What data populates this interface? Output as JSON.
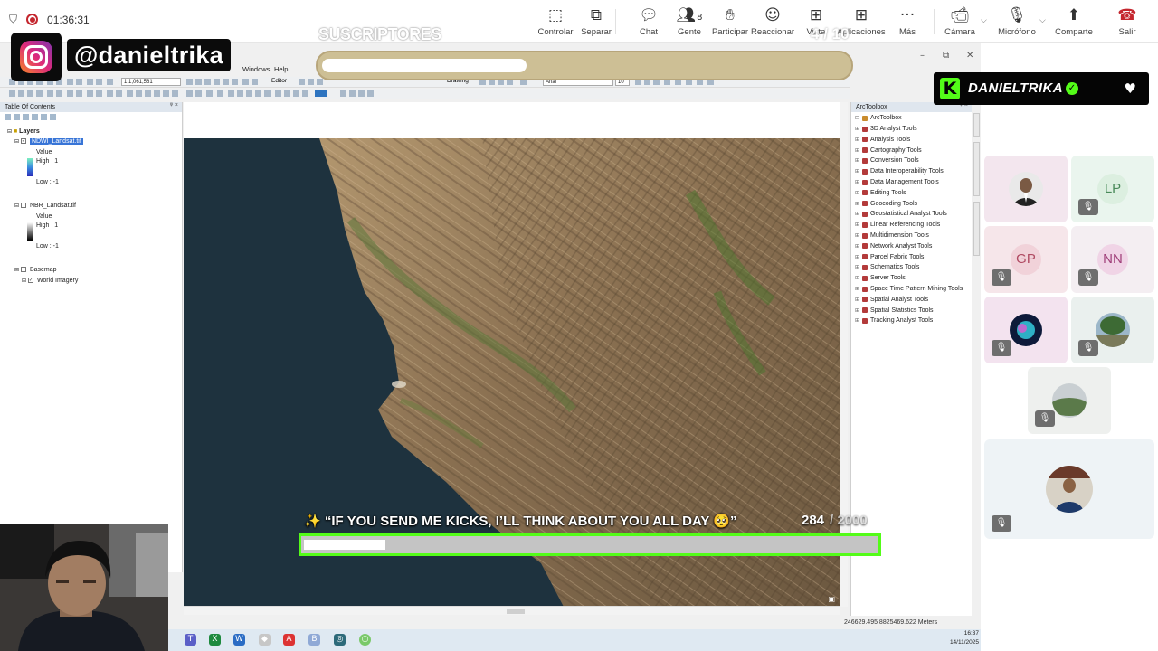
{
  "teams": {
    "timer": "01:36:31",
    "buttons": {
      "controlar": "Controlar",
      "separar": "Separar",
      "chat": "Chat",
      "gente": "Gente",
      "gente_count": "8",
      "participar": "Participar",
      "reaccionar": "Reaccionar",
      "vista": "Vista",
      "aplicaciones": "Aplicaciones",
      "mas": "Más",
      "camara": "Cámara",
      "microfono": "Micrófono",
      "compartir": "Comparte",
      "salir": "Salir"
    }
  },
  "overlays": {
    "subs_label": "SUSCRIPTORES",
    "subs_count": "4 / 10",
    "subs_progress": 0.39,
    "instagram_handle": "@danieltrika",
    "kick_name": "DANIELTRIKA",
    "kick_message": "✨ “IF YOU SEND ME KICKS, I’LL THINK ABOUT YOU ALL DAY 🥺”",
    "kick_count": "284",
    "kick_total": "/ 2000",
    "kick_progress": 0.142
  },
  "arcmap": {
    "menu": {
      "windows": "Windows",
      "help": "Help"
    },
    "scale": "1:1,061,561",
    "editor": "Editor",
    "drawing": "Drawing",
    "font": "Arial",
    "font_size": "10",
    "toc": {
      "title": "Table Of Contents",
      "layers": "Layers",
      "ndwi": "NDWI_Landsat.tif",
      "nbr": "NBR_Landsat.tif",
      "value": "Value",
      "high": "High : 1",
      "low": "Low : -1",
      "basemap": "Basemap",
      "world_imagery": "World Imagery"
    },
    "toolbox": {
      "title": "ArcToolbox",
      "root": "ArcToolbox",
      "items": [
        "3D Analyst Tools",
        "Analysis Tools",
        "Cartography Tools",
        "Conversion Tools",
        "Data Interoperability Tools",
        "Data Management Tools",
        "Editing Tools",
        "Geocoding Tools",
        "Geostatistical Analyst Tools",
        "Linear Referencing Tools",
        "Multidimension Tools",
        "Network Analyst Tools",
        "Parcel Fabric Tools",
        "Schematics Tools",
        "Server Tools",
        "Space Time Pattern Mining Tools",
        "Spatial Analyst Tools",
        "Spatial Statistics Tools",
        "Tracking Analyst Tools"
      ]
    },
    "status_coords": "246629.495  8825469.622 Meters"
  },
  "taskbar": {
    "time": "16:37",
    "date": "14/11/2025"
  },
  "participants": {
    "initials": [
      "LP",
      "GP",
      "NN"
    ]
  },
  "colors": {
    "kick_green": "#53fc18",
    "hangup_red": "#c4262e",
    "selection_blue": "#3875d7"
  },
  "icons": {
    "shield": "shield-icon",
    "record": "record-icon",
    "mute": "mic-off-icon"
  }
}
